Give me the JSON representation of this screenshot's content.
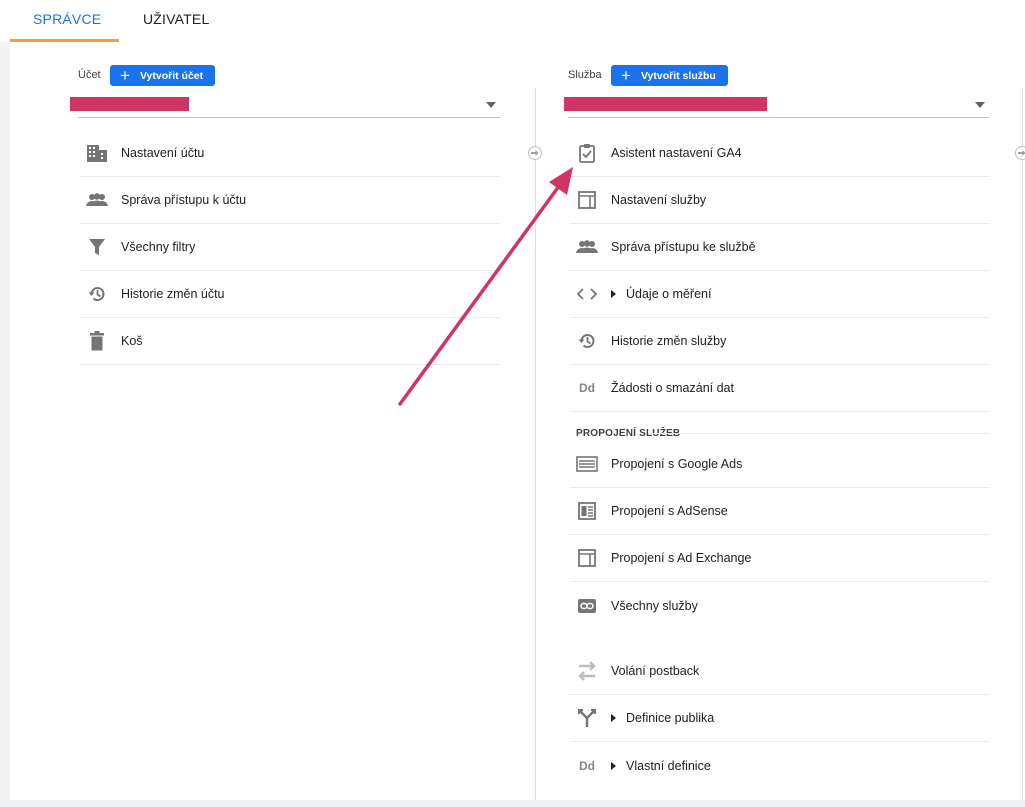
{
  "tabs": [
    {
      "label": "SPRÁVCE",
      "active": true
    },
    {
      "label": "UŽIVATEL",
      "active": false
    }
  ],
  "account": {
    "label": "Účet",
    "create_button": "Vytvořit účet",
    "items": [
      {
        "label": "Nastavení účtu",
        "icon": "building-icon"
      },
      {
        "label": "Správa přístupu k účtu",
        "icon": "people-icon"
      },
      {
        "label": "Všechny filtry",
        "icon": "filter-icon"
      },
      {
        "label": "Historie změn účtu",
        "icon": "history-icon"
      },
      {
        "label": "Koš",
        "icon": "trash-icon"
      }
    ]
  },
  "property": {
    "label": "Služba",
    "create_button": "Vytvořit službu",
    "items": [
      {
        "label": "Asistent nastavení GA4",
        "icon": "clipboard-check-icon"
      },
      {
        "label": "Nastavení služby",
        "icon": "layout-icon"
      },
      {
        "label": "Správa přístupu ke službě",
        "icon": "people-icon"
      },
      {
        "label": "Údaje o měření",
        "icon": "code-icon"
      },
      {
        "label": "Historie změn služby",
        "icon": "history-icon"
      },
      {
        "label": "Žádosti o smazání dat",
        "icon": "dd-icon"
      }
    ],
    "links_section_title": "PROPOJENÍ SLUŽEB",
    "links": [
      {
        "label": "Propojení s Google Ads",
        "icon": "ads-icon"
      },
      {
        "label": "Propojení s AdSense",
        "icon": "adsense-icon"
      },
      {
        "label": "Propojení s Ad Exchange",
        "icon": "layout-icon"
      },
      {
        "label": "Všechny služby",
        "icon": "link-icon"
      }
    ],
    "extra": [
      {
        "label": "Volání postback",
        "icon": "swap-arrows-icon"
      },
      {
        "label": "Definice publika",
        "icon": "fork-icon"
      },
      {
        "label": "Vlastní definice",
        "icon": "dd-icon"
      }
    ]
  },
  "icon_text": {
    "dd": "Dd"
  },
  "colors": {
    "accent": "#1a73e8",
    "tab_underline": "#e8a33d",
    "redaction": "#d03462",
    "arrow": "#d03462"
  }
}
